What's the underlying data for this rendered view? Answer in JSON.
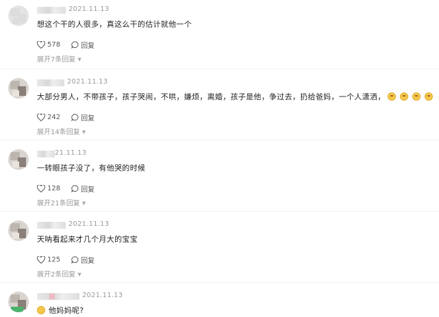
{
  "comments": [
    {
      "date": "2021.11.13",
      "text": "想这个干的人很多，真这么干的估计就他一个",
      "likes": "578",
      "reply_label": "回复",
      "expand": "展开7条回复"
    },
    {
      "date": "2021.11.13",
      "text": "大部分男人，不带孩子，孩子哭闹，不哄，嫌烦，离婚，孩子是他，争过去，扔给爸妈，一个人潇洒，",
      "emoji_count": 4,
      "emoji_icon": "smiling-face-emoji",
      "likes": "242",
      "reply_label": "回复",
      "expand": "展开14条回复"
    },
    {
      "date": "21.11.13",
      "text": "一转眼孩子没了，有他哭的时候",
      "likes": "128",
      "reply_label": "回复",
      "expand": "展开21条回复"
    },
    {
      "date": "2021.11.13",
      "text": "天呐看起来才几个月大的宝宝",
      "likes": "125",
      "reply_label": "回复",
      "expand": "展开2条回复"
    },
    {
      "date": "2021.11.13",
      "text": "他妈妈呢?",
      "emoji_icon": "smiling-face-emoji"
    }
  ],
  "icons": {
    "like": "heart-outline-icon",
    "reply": "speech-bubble-icon",
    "expand": "caret-down-icon"
  },
  "colors": {
    "text": "#222222",
    "meta": "#999999",
    "divider": "#f2f2f2",
    "emoji": "#f6c84a"
  }
}
